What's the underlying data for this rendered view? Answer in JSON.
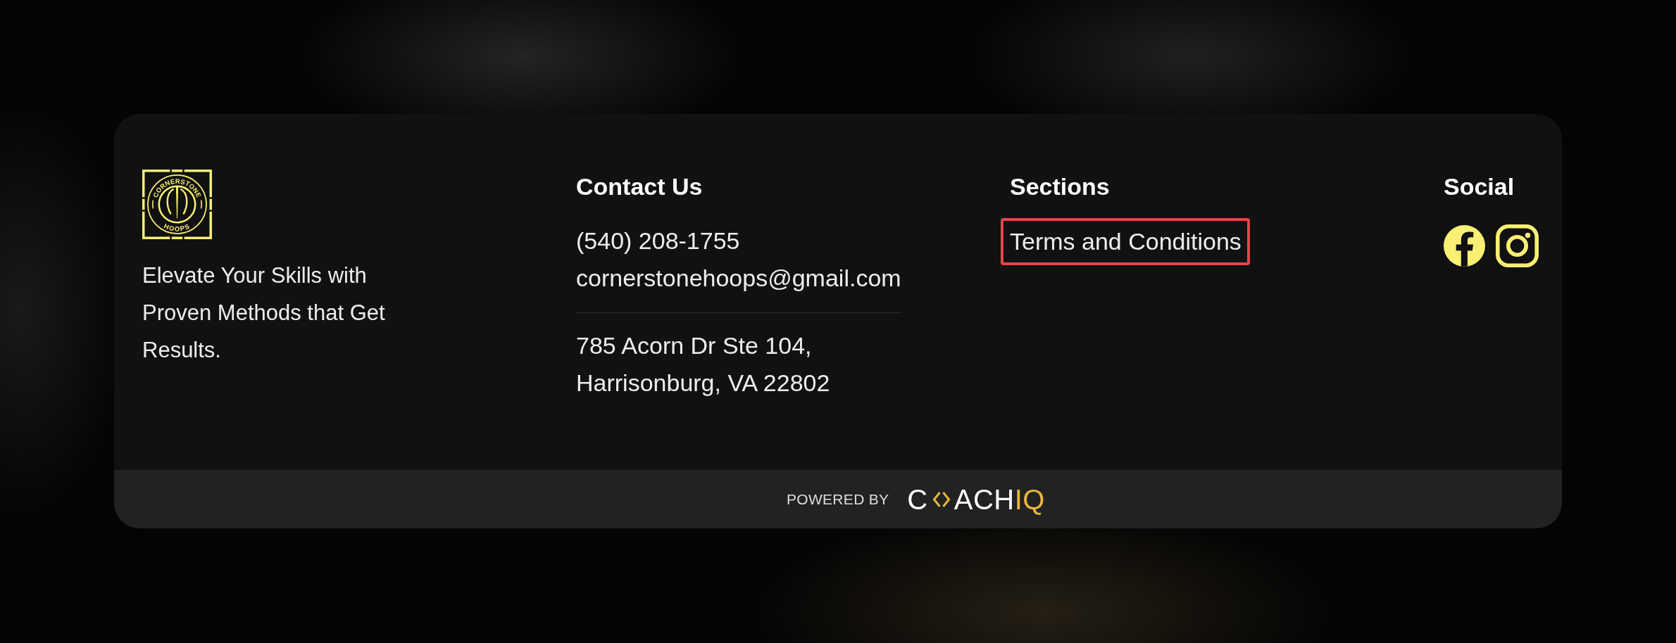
{
  "brand": {
    "logo": {
      "ring_top": "CORNERSTONE",
      "ring_bottom": "HOOPS"
    },
    "tagline": "Elevate Your Skills with Proven Methods that Get Results."
  },
  "contact": {
    "heading": "Contact Us",
    "phone": "(540) 208-1755",
    "email": "cornerstonehoops@gmail.com",
    "address": [
      "785 Acorn Dr Ste 104,",
      "Harrisonburg, VA 22802"
    ]
  },
  "sections": {
    "heading": "Sections",
    "links": [
      {
        "label": "Terms and Conditions",
        "highlighted": true
      }
    ]
  },
  "social": {
    "heading": "Social",
    "links": [
      {
        "kind": "facebook"
      },
      {
        "kind": "instagram"
      }
    ]
  },
  "powered_by": {
    "label": "POWERED BY",
    "brand": {
      "start": "C",
      "end": "ACH",
      "accent": "IQ"
    }
  }
}
